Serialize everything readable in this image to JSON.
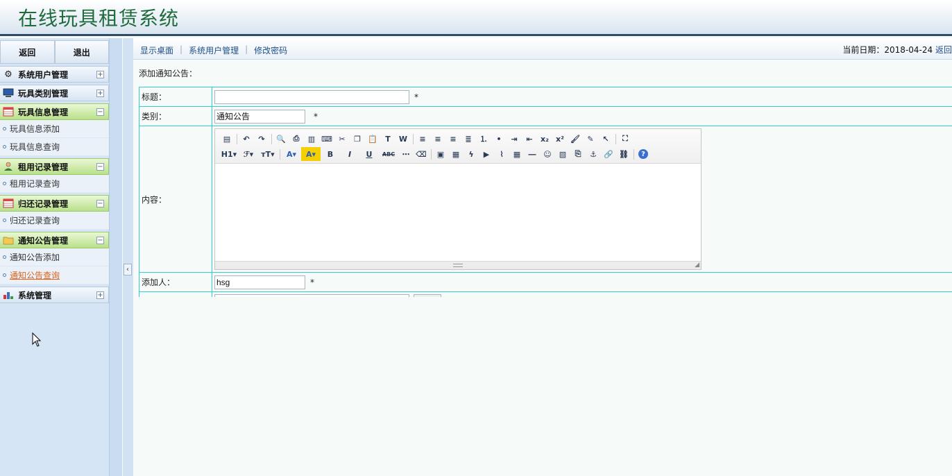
{
  "app": {
    "title": "在线玩具租赁系统"
  },
  "sidebar": {
    "back_label": "返回",
    "logout_label": "退出",
    "groups": [
      {
        "label": "系统用户管理",
        "icon": "gear-icon",
        "toggle": "+",
        "open": false,
        "items": []
      },
      {
        "label": "玩具类别管理",
        "icon": "monitor-icon",
        "toggle": "+",
        "open": false,
        "items": []
      },
      {
        "label": "玩具信息管理",
        "icon": "calendar-icon",
        "toggle": "−",
        "open": true,
        "items": [
          "玩具信息添加",
          "玩具信息查询"
        ]
      },
      {
        "label": "租用记录管理",
        "icon": "user-icon",
        "toggle": "−",
        "open": true,
        "items": [
          "租用记录查询"
        ]
      },
      {
        "label": "归还记录管理",
        "icon": "calendar-icon",
        "toggle": "−",
        "open": true,
        "items": [
          "归还记录查询"
        ]
      },
      {
        "label": "通知公告管理",
        "icon": "folder-icon",
        "toggle": "−",
        "open": true,
        "items": [
          "通知公告添加",
          "通知公告查询"
        ]
      },
      {
        "label": "系统管理",
        "icon": "chart-icon",
        "toggle": "+",
        "open": false,
        "items": []
      }
    ],
    "collapse_glyph": "‹"
  },
  "topnav": {
    "links": [
      "显示桌面",
      "系统用户管理",
      "修改密码"
    ],
    "date_label": "当前日期：2018-04-24",
    "back_label": "返回"
  },
  "page": {
    "heading": "添加通知公告："
  },
  "form": {
    "title": {
      "label": "标题：",
      "value": "",
      "required": "*"
    },
    "category": {
      "label": "类别：",
      "value": "通知公告",
      "required": "*"
    },
    "content": {
      "label": "内容："
    },
    "author": {
      "label": "添加人：",
      "value": "hsg",
      "required": "*"
    }
  },
  "editor": {
    "row1": [
      "source",
      "|",
      "undo",
      "redo",
      "|",
      "preview",
      "print",
      "template",
      "code",
      "cut",
      "copy",
      "paste",
      "paste-text",
      "paste-word",
      "|",
      "align-left",
      "align-center",
      "align-right",
      "align-justify",
      "ordered-list",
      "unordered-list",
      "indent",
      "outdent",
      "subscript",
      "superscript",
      "clear-format",
      "select-all",
      "select",
      "|",
      "fullscreen"
    ],
    "row2": [
      "H1▾",
      "ℱ▾",
      "тT▾",
      "|",
      "A▾",
      "A▾",
      "B",
      "I",
      "U",
      "ABC",
      "hr-dash",
      "eraser",
      "|",
      "image",
      "multi-image",
      "flash",
      "media",
      "attach",
      "table",
      "hr",
      "emoticon",
      "image-alt",
      "pagebreak",
      "anchor",
      "link",
      "unlink",
      "|",
      "help"
    ]
  }
}
